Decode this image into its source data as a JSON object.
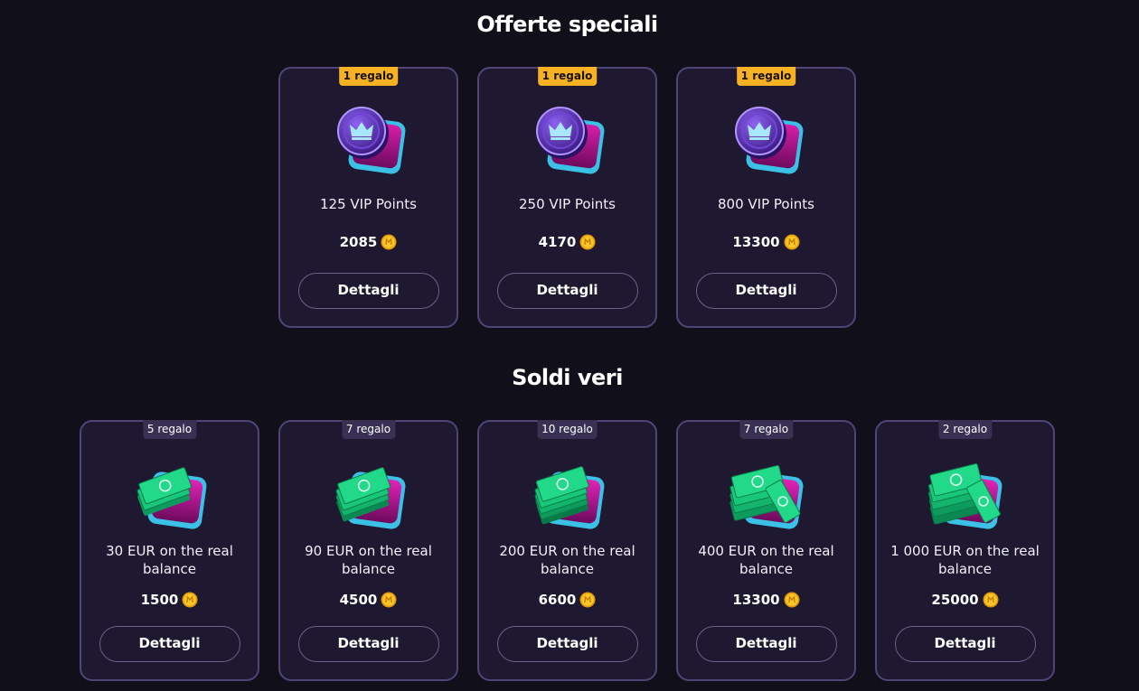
{
  "special": {
    "title": "Offerte speciali",
    "items": [
      {
        "badge": "1 regalo",
        "name": "125 VIP Points",
        "price": "2085",
        "button": "Dettagli",
        "icon": "vip-crown-coin-icon"
      },
      {
        "badge": "1 regalo",
        "name": "250 VIP Points",
        "price": "4170",
        "button": "Dettagli",
        "icon": "vip-crown-coin-icon"
      },
      {
        "badge": "1 regalo",
        "name": "800 VIP Points",
        "price": "13300",
        "button": "Dettagli",
        "icon": "vip-crown-coin-icon"
      }
    ]
  },
  "money": {
    "title": "Soldi veri",
    "items": [
      {
        "badge": "5 regalo",
        "name": "30 EUR on the real balance",
        "price": "1500",
        "button": "Dettagli",
        "icon": "cash-stack-icon"
      },
      {
        "badge": "7 regalo",
        "name": "90 EUR on the real balance",
        "price": "4500",
        "button": "Dettagli",
        "icon": "cash-stack-icon"
      },
      {
        "badge": "10 regalo",
        "name": "200 EUR on the real balance",
        "price": "6600",
        "button": "Dettagli",
        "icon": "cash-stack-icon"
      },
      {
        "badge": "7 regalo",
        "name": "400 EUR on the real balance",
        "price": "13300",
        "button": "Dettagli",
        "icon": "cash-stack-icon"
      },
      {
        "badge": "2 regalo",
        "name": "1 000 EUR on the real balance",
        "price": "25000",
        "button": "Dettagli",
        "icon": "cash-stack-icon"
      }
    ]
  },
  "colors": {
    "background": "#100f1a",
    "card": "#1e1930",
    "card_border": "#4f4576",
    "badge_gold": "#f6b223",
    "badge_muted": "#383153",
    "coin": "#f5b81c"
  }
}
